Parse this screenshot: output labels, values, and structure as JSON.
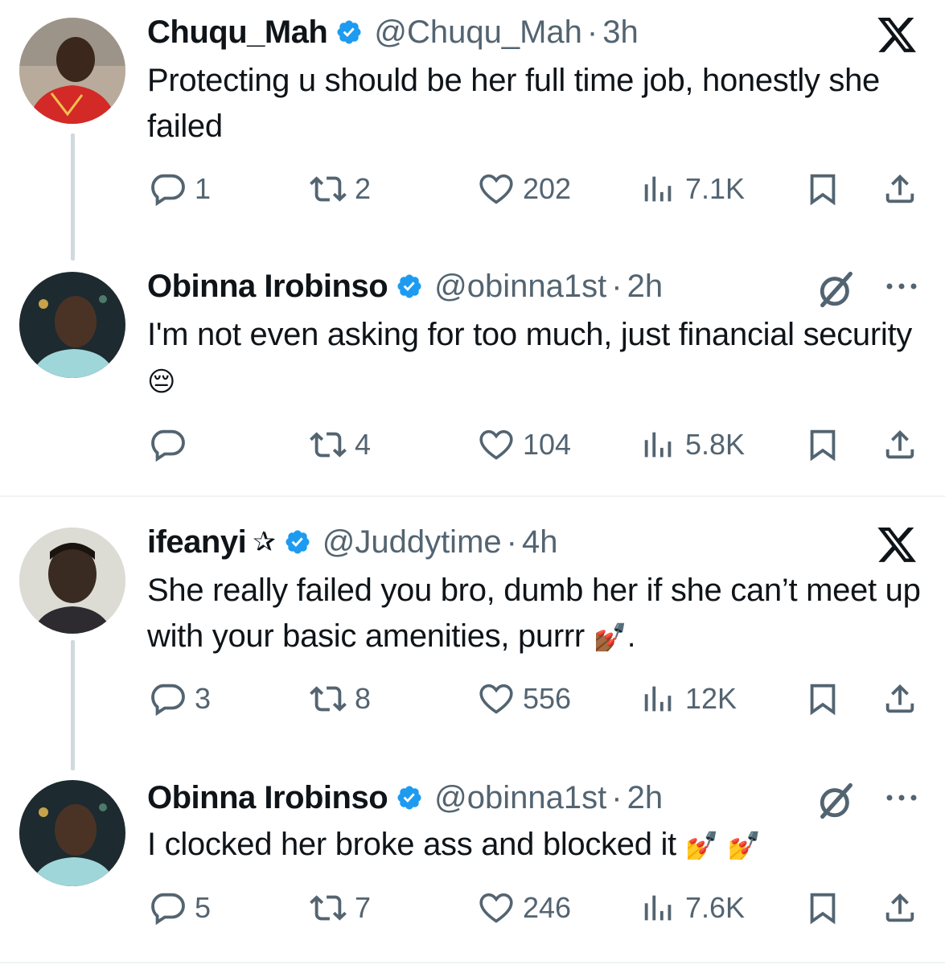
{
  "tweets": [
    {
      "name": "Chuqu_Mah",
      "handle": "@Chuqu_Mah",
      "dot": "·",
      "time": "3h",
      "text": "Protecting u should be her full time job, honestly she failed",
      "emoji": "",
      "replies": "1",
      "retweets": "2",
      "likes": "202",
      "views": "7.1K",
      "top_icon": "x-logo-icon",
      "avatar_colors": [
        "#b5a99a",
        "#d02b2b"
      ]
    },
    {
      "name": "Obinna Irobinso",
      "handle": "@obinna1st",
      "dot": "·",
      "time": "2h",
      "text": "I'm not even asking for too much, just financial security",
      "emoji": "😔",
      "replies": "",
      "retweets": "4",
      "likes": "104",
      "views": "5.8K",
      "top_icon": "grok-icon",
      "avatar_colors": [
        "#1d2a2f",
        "#9fd6d9"
      ]
    },
    {
      "name": "ifeanyi",
      "star": "✰",
      "handle": "@Juddytime",
      "dot": "·",
      "time": "4h",
      "text": "She really failed you bro, dumb her if she can’t meet up with your basic amenities, purrr",
      "emoji": "💅🏾.",
      "replies": "3",
      "retweets": "8",
      "likes": "556",
      "views": "12K",
      "top_icon": "x-logo-icon",
      "avatar_colors": [
        "#d9d9d2",
        "#3a2b22"
      ]
    },
    {
      "name": "Obinna Irobinso",
      "handle": "@obinna1st",
      "dot": "·",
      "time": "2h",
      "text": "I clocked her broke ass and blocked it",
      "emoji": "💅 💅",
      "replies": "5",
      "retweets": "7",
      "likes": "246",
      "views": "7.6K",
      "top_icon": "grok-icon",
      "avatar_colors": [
        "#1d2a2f",
        "#9fd6d9"
      ]
    }
  ],
  "colors": {
    "verified": "#1d9bf0",
    "secondary_text": "#536471",
    "thread_line": "#cfd9de",
    "divider": "#eff3f4"
  }
}
